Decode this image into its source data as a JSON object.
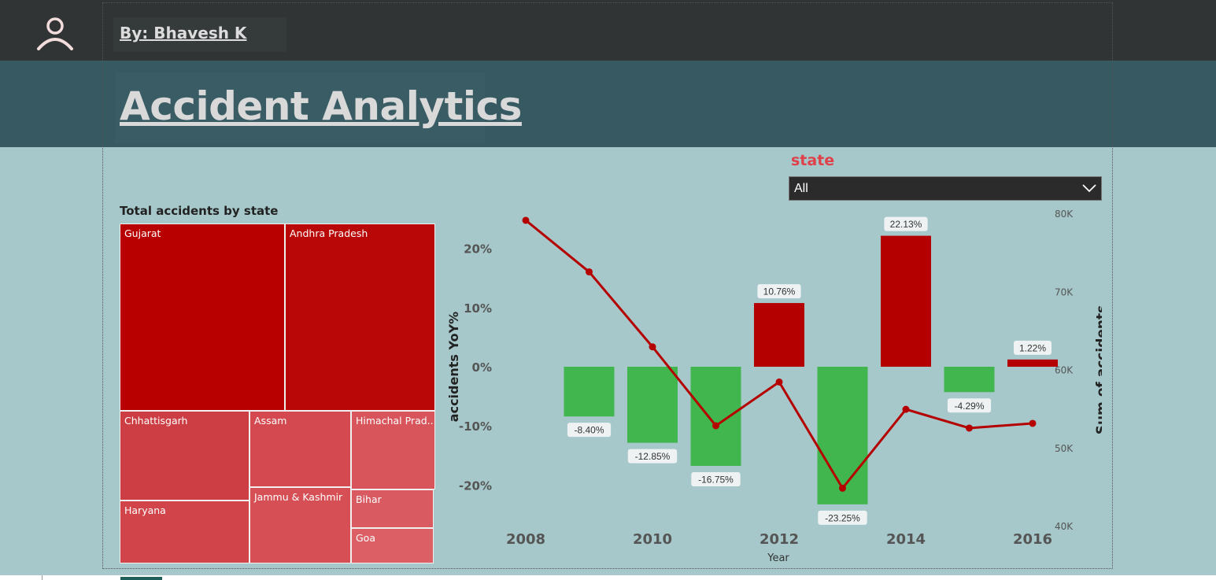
{
  "header": {
    "byline": "By: Bhavesh K",
    "title": "Accident Analytics",
    "user_icon": "user-icon"
  },
  "slicer": {
    "label": "state",
    "value": "All",
    "icon": "chevron-down-icon"
  },
  "treemap": {
    "title": "Total accidents by state",
    "tiles": [
      {
        "label": "Gujarat",
        "color": "#b90000"
      },
      {
        "label": "Andhra Pradesh",
        "color": "#b90707"
      },
      {
        "label": "Chhattisgarh",
        "color": "#cd3e44"
      },
      {
        "label": "Assam",
        "color": "#d4494f"
      },
      {
        "label": "Himachal Prad...",
        "color": "#d8555c"
      },
      {
        "label": "Haryana",
        "color": "#d0444a"
      },
      {
        "label": "Jammu & Kashmir",
        "color": "#d64f55"
      },
      {
        "label": "Bihar",
        "color": "#d95a61"
      },
      {
        "label": "Goa",
        "color": "#db5f65"
      }
    ]
  },
  "chart_data": {
    "type": "bar",
    "x": [
      2009,
      2010,
      2011,
      2012,
      2013,
      2014,
      2015,
      2016
    ],
    "series": [
      {
        "values": [
          -8.4,
          -12.85,
          -16.75,
          10.76,
          -23.25,
          22.13,
          -4.29,
          1.22
        ],
        "labels": [
          "-8.40%",
          "-12.85%",
          "-16.75%",
          "10.76%",
          "-23.25%",
          "22.13%",
          "-4.29%",
          "1.22%"
        ]
      },
      {
        "x": [
          2008,
          2009,
          2010,
          2011,
          2012,
          2013,
          2014,
          2015,
          2016
        ],
        "values": [
          79200,
          72600,
          63000,
          52900,
          58500,
          44900,
          55000,
          52600,
          53200
        ]
      }
    ],
    "colors": {
      "positive": "#b50000",
      "negative": "#41b64e",
      "line": "#b50000"
    },
    "xlabel": "Year",
    "ylabel": "accidents YoY%",
    "y2label": "Sum of accidents",
    "ylim": [
      -25,
      25
    ],
    "y2lim": [
      40000,
      80000
    ],
    "yticks": [
      "20%",
      "10%",
      "0%",
      "-10%",
      "-20%"
    ],
    "y2ticks": [
      "80K",
      "70K",
      "60K",
      "50K",
      "40K"
    ],
    "xticks": [
      "2008",
      "2010",
      "2012",
      "2014",
      "2016"
    ],
    "grid": false
  }
}
